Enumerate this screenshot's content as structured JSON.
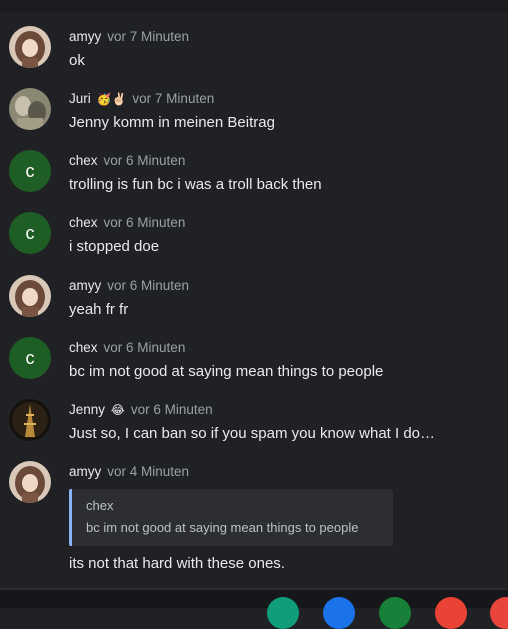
{
  "messages": [
    {
      "name": "amyy",
      "emoji": "",
      "time": "vor 7 Minuten",
      "text": "ok",
      "avatar": "amyy-avatar"
    },
    {
      "name": "Juri",
      "emoji": "🥳✌🏻",
      "time": "vor 7 Minuten",
      "text": "Jenny komm in meinen Beitrag",
      "avatar": "juri-avatar"
    },
    {
      "name": "chex",
      "emoji": "",
      "time": "vor 6 Minuten",
      "text": "trolling is fun bc i was a troll back then",
      "avatar_letter": "c"
    },
    {
      "name": "chex",
      "emoji": "",
      "time": "vor 6 Minuten",
      "text": "i stopped doe",
      "avatar_letter": "c"
    },
    {
      "name": "amyy",
      "emoji": "",
      "time": "vor 6 Minuten",
      "text": "yeah fr fr",
      "avatar": "amyy-avatar"
    },
    {
      "name": "chex",
      "emoji": "",
      "time": "vor 6 Minuten",
      "text": "bc im not good at saying mean things to people",
      "avatar_letter": "c"
    },
    {
      "name": "Jenny",
      "emoji": "😂",
      "time": "vor 6 Minuten",
      "text": "Just so, I can ban so if you spam you know what I do…",
      "avatar": "jenny-avatar"
    },
    {
      "name": "amyy",
      "emoji": "",
      "time": "vor 4 Minuten",
      "text": "its not that hard with these ones.",
      "avatar": "amyy-avatar",
      "quote": {
        "name": "chex",
        "text": "bc im not good at saying mean things to people"
      }
    }
  ],
  "colors": {
    "background": "#202124",
    "chex_avatar": "#1e5e25",
    "quote_bar": "#8ab4f8"
  },
  "shelf": {
    "apps": [
      "meet-icon",
      "files-icon",
      "sheets-icon",
      "chrome-icon",
      "chrome-icon"
    ]
  }
}
